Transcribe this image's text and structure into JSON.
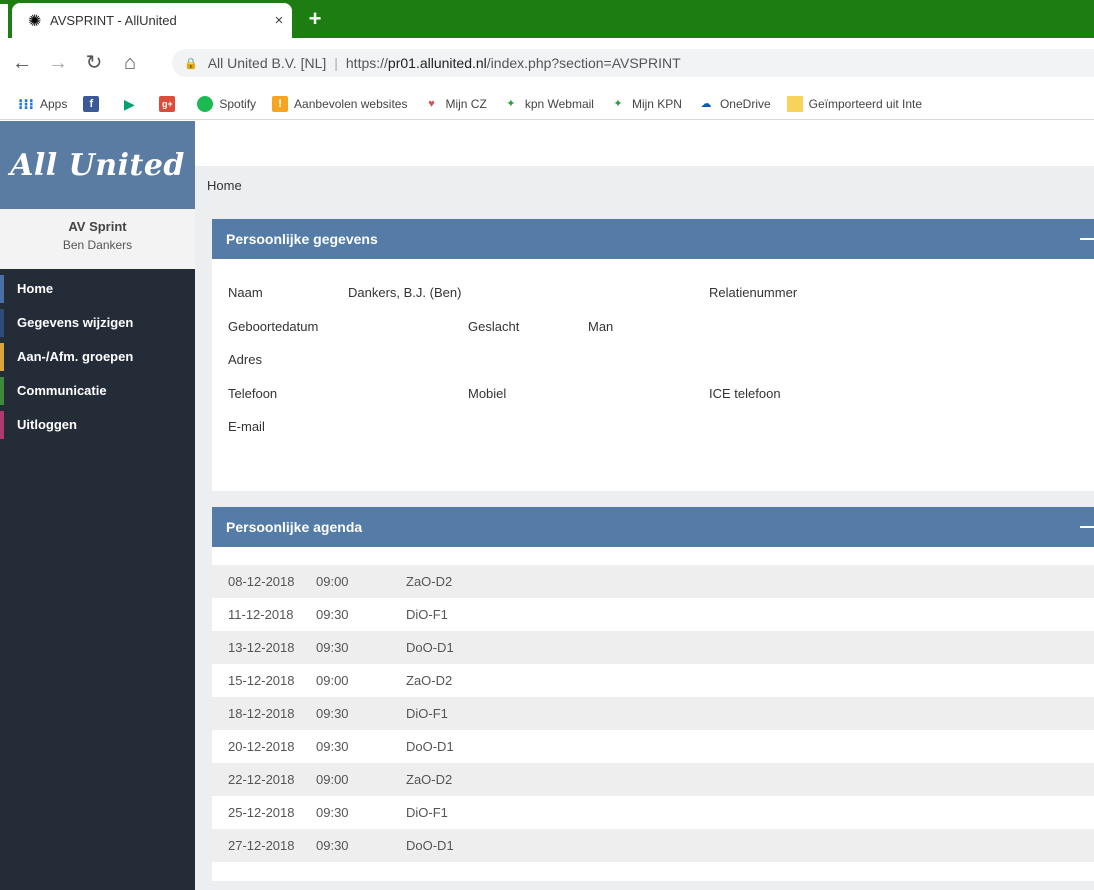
{
  "browser": {
    "tab_title": "AVSPRINT - AllUnited",
    "tab_close": "×",
    "new_tab": "+",
    "address": {
      "site_info": "All United B.V. [NL]",
      "url_prefix": "https://",
      "url_domain": "pr01.allunited.nl",
      "url_path": "/index.php?section=AVSPRINT"
    },
    "bookmarks": [
      "Apps",
      "",
      "",
      "",
      "Spotify",
      "Aanbevolen websites",
      "Mijn CZ",
      "kpn Webmail",
      "Mijn KPN",
      "OneDrive",
      "Geïmporteerd uit Inte"
    ]
  },
  "sidebar": {
    "logo": "All United",
    "club": "AV Sprint",
    "user": "Ben Dankers",
    "menu": [
      {
        "label": "Home",
        "accent": "#4a6fa5"
      },
      {
        "label": "Gegevens wijzigen",
        "accent": "#2f4b7c"
      },
      {
        "label": "Aan-/Afm. groepen",
        "accent": "#d9a43b"
      },
      {
        "label": "Communicatie",
        "accent": "#3f8a3a"
      },
      {
        "label": "Uitloggen",
        "accent": "#b03a6e"
      }
    ]
  },
  "breadcrumb": "Home",
  "personal": {
    "title": "Persoonlijke gegevens",
    "naam_label": "Naam",
    "naam_value": "Dankers, B.J. (Ben)",
    "relatienummer_label": "Relatienummer",
    "geboortedatum_label": "Geboortedatum",
    "geslacht_label": "Geslacht",
    "geslacht_value": "Man",
    "adres_label": "Adres",
    "telefoon_label": "Telefoon",
    "mobiel_label": "Mobiel",
    "ice_label": "ICE telefoon",
    "email_label": "E-mail"
  },
  "agenda": {
    "title": "Persoonlijke agenda",
    "rows": [
      {
        "date": "08-12-2018",
        "time": "09:00",
        "group": "ZaO-D2"
      },
      {
        "date": "11-12-2018",
        "time": "09:30",
        "group": "DiO-F1"
      },
      {
        "date": "13-12-2018",
        "time": "09:30",
        "group": "DoO-D1"
      },
      {
        "date": "15-12-2018",
        "time": "09:00",
        "group": "ZaO-D2"
      },
      {
        "date": "18-12-2018",
        "time": "09:30",
        "group": "DiO-F1"
      },
      {
        "date": "20-12-2018",
        "time": "09:30",
        "group": "DoO-D1"
      },
      {
        "date": "22-12-2018",
        "time": "09:00",
        "group": "ZaO-D2"
      },
      {
        "date": "25-12-2018",
        "time": "09:30",
        "group": "DiO-F1"
      },
      {
        "date": "27-12-2018",
        "time": "09:30",
        "group": "DoO-D1"
      }
    ]
  }
}
